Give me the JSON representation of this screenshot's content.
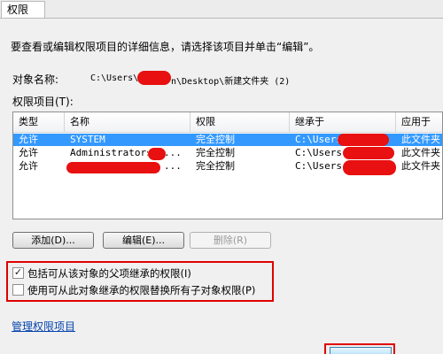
{
  "tab": {
    "label": "权限"
  },
  "instruction": "要查看或编辑权限项目的详细信息，请选择该项目并单击“编辑”。",
  "object_name": {
    "label": "对象名称:",
    "path_start": "C:\\Users\\",
    "path_end": "n\\Desktop\\新建文件夹 (2)"
  },
  "permissions_label": "权限项目(T):",
  "table": {
    "headers": [
      "类型",
      "名称",
      "权限",
      "继承于",
      "应用于"
    ],
    "rows": [
      {
        "type": "允许",
        "name": "SYSTEM",
        "permission": "完全控制",
        "inherited_from": "C:\\Users",
        "applies_to": "此文件夹",
        "selected": true
      },
      {
        "type": "允许",
        "name": "Administrators",
        "name_suffix": "...",
        "permission": "完全控制",
        "inherited_from": "C:\\Users",
        "applies_to": "此文件夹",
        "selected": false
      },
      {
        "type": "允许",
        "name": "",
        "name_suffix": "...",
        "permission": "完全控制",
        "inherited_from": "C:\\Users",
        "applies_to": "此文件夹",
        "selected": false
      }
    ]
  },
  "buttons": {
    "add": "添加(D)...",
    "edit": "编辑(E)...",
    "remove": "删除(R)"
  },
  "checkboxes": [
    {
      "label": "包括可从该对象的父项继承的权限(I)",
      "checked": true
    },
    {
      "label": "使用可从此对象继承的权限替换所有子对象权限(P)",
      "checked": false
    }
  ],
  "manage_link": "管理权限项目",
  "colors": {
    "selection": "#3399ff",
    "highlight": "#e00000",
    "link": "#0645ad"
  }
}
